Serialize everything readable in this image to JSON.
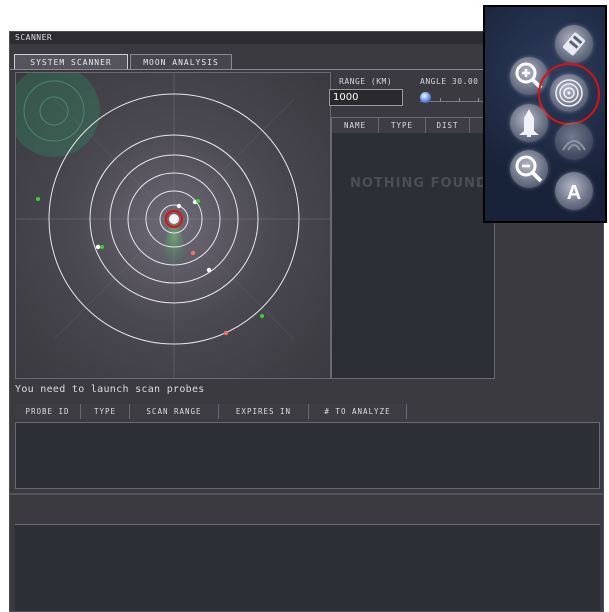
{
  "window": {
    "title": "SCANNER",
    "tabs": [
      {
        "label": "SYSTEM SCANNER",
        "active": true
      },
      {
        "label": "MOON ANALYSIS",
        "active": false
      }
    ]
  },
  "controls": {
    "range_label": "RANGE (KM)",
    "range_value": "1000",
    "angle_label": "ANGLE 30.00",
    "angle_value": 30.0
  },
  "results": {
    "columns": [
      "NAME",
      "TYPE",
      "DIST"
    ],
    "empty_text": "NOTHING FOUND"
  },
  "probes": {
    "message": "You need to launch scan probes",
    "columns": [
      "PROBE ID",
      "TYPE",
      "SCAN RANGE",
      "EXPIRES IN",
      "# TO ANALYZE"
    ]
  },
  "overlay": {
    "buttons": [
      {
        "name": "probe-icon"
      },
      {
        "name": "zoom-in-icon"
      },
      {
        "name": "scan-icon",
        "highlighted": true
      },
      {
        "name": "launch-icon"
      },
      {
        "name": "zoom-out-icon"
      },
      {
        "name": "analyze-icon",
        "label": "A"
      }
    ]
  },
  "colors": {
    "highlight": "#e01010",
    "panel": "#3b3a40",
    "list_bg": "#2c3036"
  }
}
